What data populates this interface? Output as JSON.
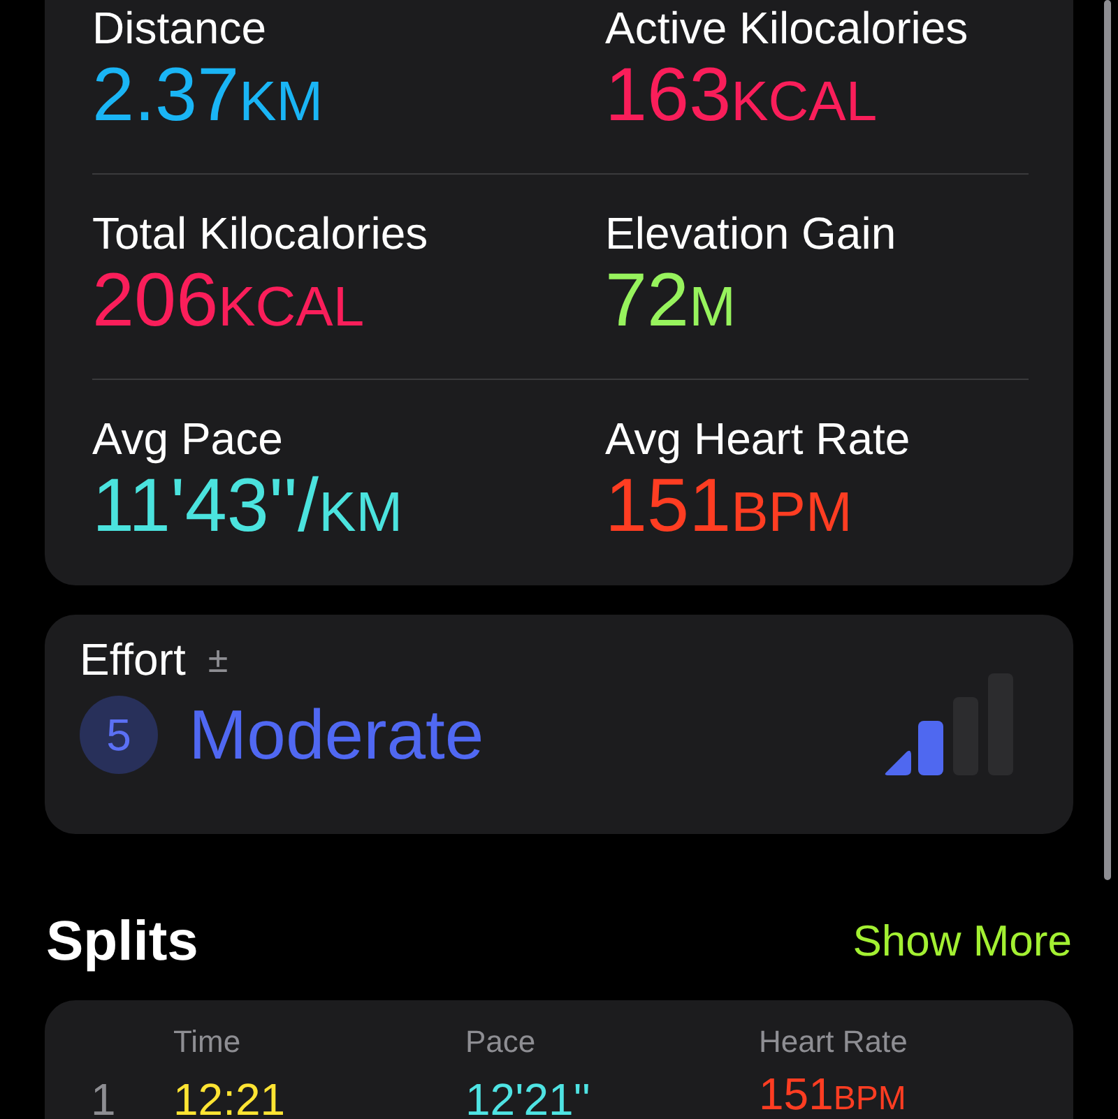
{
  "metrics": [
    {
      "label": "Distance",
      "value": "2.37",
      "unit": "KM",
      "color": "#1ab5f5"
    },
    {
      "label": "Active Kilocalories",
      "value": "163",
      "unit": "KCAL",
      "color": "#fa1e5a"
    },
    {
      "label": "Total Kilocalories",
      "value": "206",
      "unit": "KCAL",
      "color": "#fa1e5a"
    },
    {
      "label": "Elevation Gain",
      "value": "72",
      "unit": "M",
      "color": "#97f35d"
    },
    {
      "label": "Avg Pace",
      "value": "11'43''/",
      "unit": "KM",
      "color": "#4be3de"
    },
    {
      "label": "Avg Heart Rate",
      "value": "151",
      "unit": "BPM",
      "color": "#ff3d22"
    }
  ],
  "effort": {
    "title": "Effort",
    "adjust_symbol": "±",
    "score": "5",
    "label": "Moderate"
  },
  "splits": {
    "title": "Splits",
    "action": "Show More",
    "columns": [
      "Time",
      "Pace",
      "Heart Rate"
    ],
    "rows": [
      {
        "index": "1",
        "time": "12:21",
        "pace": "12'21''",
        "heart_rate": "151",
        "heart_rate_unit": "BPM"
      }
    ]
  }
}
